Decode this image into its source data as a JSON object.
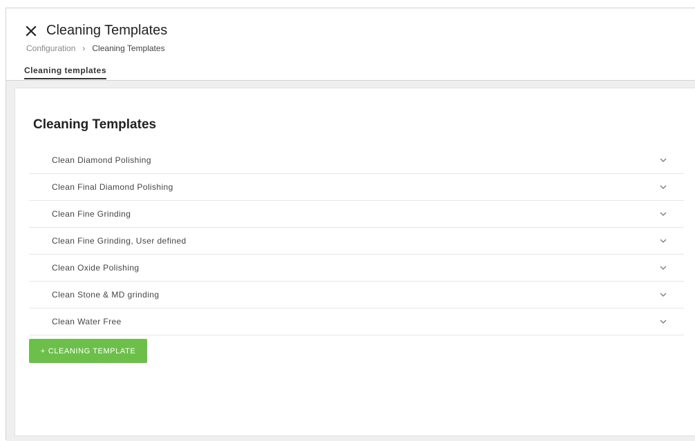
{
  "header": {
    "title": "Cleaning Templates",
    "breadcrumb": {
      "parent": "Configuration",
      "separator": "›",
      "current": "Cleaning Templates"
    },
    "tabs": [
      {
        "label": "Cleaning templates",
        "active": true
      }
    ]
  },
  "card": {
    "title": "Cleaning Templates",
    "items": [
      {
        "label": "Clean Diamond Polishing"
      },
      {
        "label": "Clean Final Diamond Polishing"
      },
      {
        "label": "Clean Fine Grinding"
      },
      {
        "label": "Clean Fine Grinding, User defined"
      },
      {
        "label": "Clean Oxide Polishing"
      },
      {
        "label": "Clean Stone & MD grinding"
      },
      {
        "label": "Clean Water Free"
      }
    ],
    "add_button": {
      "plus": "+",
      "label": "CLEANING TEMPLATE"
    }
  },
  "icons": {
    "close": "close-icon",
    "expand": "chevron-down-icon"
  },
  "colors": {
    "accent_green": "#6cc04a",
    "content_background": "#efefef"
  }
}
